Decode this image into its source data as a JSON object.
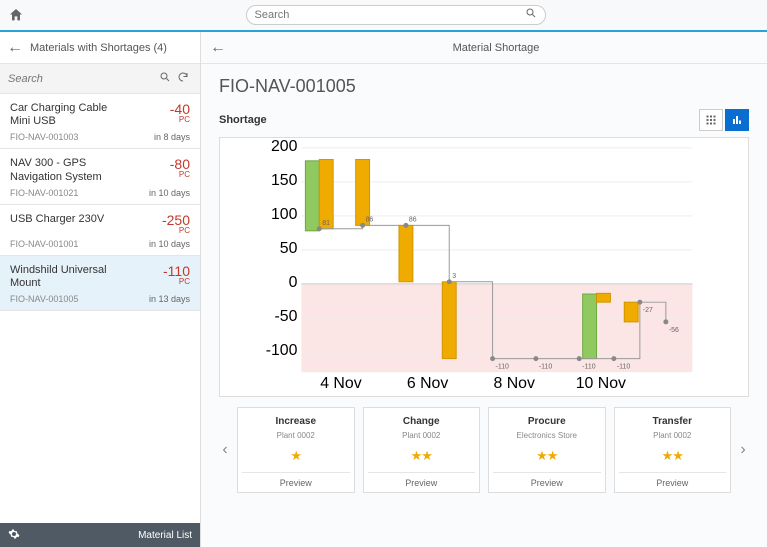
{
  "top": {
    "search_placeholder": "Search"
  },
  "list": {
    "title": "Materials with Shortages (4)",
    "search_placeholder": "Search",
    "footer_link": "Material List",
    "items": [
      {
        "name": "Car Charging Cable Mini USB",
        "qty": "-40",
        "unit": "PC",
        "id": "FIO-NAV-001003",
        "due": "in 8 days"
      },
      {
        "name": "NAV 300 - GPS Navigation System",
        "qty": "-80",
        "unit": "PC",
        "id": "FIO-NAV-001021",
        "due": "in 10 days"
      },
      {
        "name": "USB Charger 230V",
        "qty": "-250",
        "unit": "PC",
        "id": "FIO-NAV-001001",
        "due": "in 10 days"
      },
      {
        "name": "Windshild Universal Mount",
        "qty": "-110",
        "unit": "PC",
        "id": "FIO-NAV-001005",
        "due": "in 13 days"
      }
    ],
    "selected_index": 3
  },
  "detail": {
    "title": "Material Shortage",
    "material_id": "FIO-NAV-001005",
    "section": "Shortage"
  },
  "chart_data": {
    "type": "bar",
    "ylabel": "",
    "ylim": [
      -130,
      200
    ],
    "yticks": [
      -100,
      -50,
      0,
      50,
      100,
      150,
      200
    ],
    "xticks": [
      "4 Nov",
      "6 Nov",
      "8 Nov",
      "10 Nov"
    ],
    "bars": [
      {
        "x": 0,
        "green": [
          78,
          181
        ],
        "orange": [
          81,
          183
        ]
      },
      {
        "x": 1,
        "green": null,
        "orange": [
          86,
          183
        ]
      },
      {
        "x": 2,
        "green": null,
        "orange": [
          3,
          86
        ]
      },
      {
        "x": 3,
        "green": null,
        "orange": [
          -110,
          3
        ]
      },
      {
        "x": 6.4,
        "green": [
          -110,
          -15
        ],
        "orange": [
          -27,
          -14
        ]
      },
      {
        "x": 7.2,
        "green": null,
        "orange": [
          -56,
          -27
        ]
      }
    ],
    "step_points": [
      {
        "x": 0,
        "y": 81,
        "label": "81"
      },
      {
        "x": 1,
        "y": 86,
        "label": "86"
      },
      {
        "x": 2,
        "y": 86,
        "label": "86"
      },
      {
        "x": 3,
        "y": 3,
        "label": "3"
      },
      {
        "x": 4,
        "y": -110,
        "label": "-110"
      },
      {
        "x": 5,
        "y": -110,
        "label": "-110"
      },
      {
        "x": 6,
        "y": -110,
        "label": "-110"
      },
      {
        "x": 6.8,
        "y": -110,
        "label": "-110"
      },
      {
        "x": 7.4,
        "y": -27,
        "label": "-27"
      },
      {
        "x": 8,
        "y": -56,
        "label": "-56"
      }
    ]
  },
  "cards": [
    {
      "title": "Increase",
      "sub": "Plant 0002",
      "stars": "★",
      "preview": "Preview"
    },
    {
      "title": "Change",
      "sub": "Plant 0002",
      "stars": "★★",
      "preview": "Preview"
    },
    {
      "title": "Procure",
      "sub": "Electronics Store",
      "stars": "★★",
      "preview": "Preview"
    },
    {
      "title": "Transfer",
      "sub": "Plant 0002",
      "stars": "★★",
      "preview": "Preview"
    }
  ]
}
